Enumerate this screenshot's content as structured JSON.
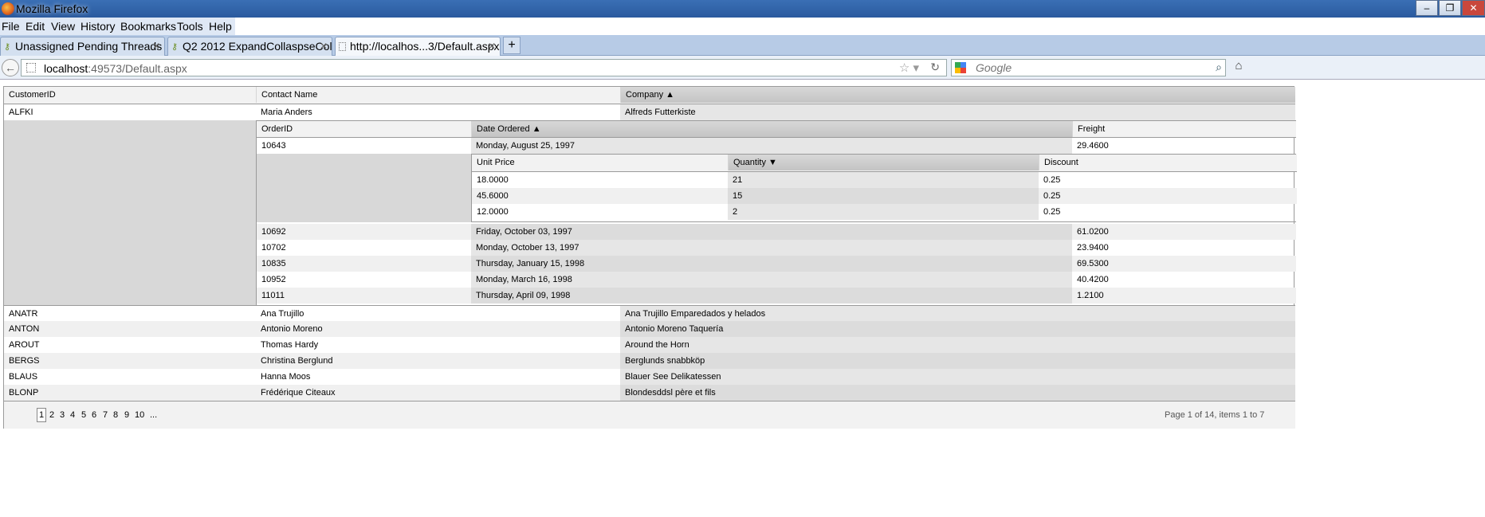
{
  "window": {
    "title": "Mozilla Firefox",
    "controls": [
      "–",
      "❐",
      "✕"
    ]
  },
  "menu": [
    "File",
    "Edit",
    "View",
    "History",
    "Bookmarks",
    "Tools",
    "Help"
  ],
  "tabs": [
    {
      "label": "Unassigned Pending Threads",
      "icon": "key-icon"
    },
    {
      "label": "Q2 2012 ExpandCollaspseCol...",
      "icon": "key-icon"
    },
    {
      "label": "http://localhos...3/Default.aspx",
      "icon": "page-icon"
    }
  ],
  "newtab": "+",
  "nav": {
    "url_host": "localhost",
    "url_rest": ":49573/Default.aspx",
    "search_placeholder": "Google"
  },
  "grid": {
    "headers": {
      "customer_id": "CustomerID",
      "contact": "Contact Name",
      "company": "Company ▲"
    },
    "customers_top": [
      {
        "id": "ALFKI",
        "contact": "Maria Anders",
        "company": "Alfreds Futterkiste"
      }
    ],
    "orders_headers": {
      "order_id": "OrderID",
      "date": "Date Ordered ▲",
      "freight": "Freight"
    },
    "order_first": {
      "id": "10643",
      "date": "Monday, August 25, 1997",
      "freight": "29.4600"
    },
    "details_headers": {
      "price": "Unit Price",
      "qty": "Quantity ▼",
      "discount": "Discount"
    },
    "details": [
      {
        "price": "18.0000",
        "qty": "21",
        "discount": "0.25"
      },
      {
        "price": "45.6000",
        "qty": "15",
        "discount": "0.25"
      },
      {
        "price": "12.0000",
        "qty": "2",
        "discount": "0.25"
      }
    ],
    "orders": [
      {
        "id": "10692",
        "date": "Friday, October 03, 1997",
        "freight": "61.0200"
      },
      {
        "id": "10702",
        "date": "Monday, October 13, 1997",
        "freight": "23.9400"
      },
      {
        "id": "10835",
        "date": "Thursday, January 15, 1998",
        "freight": "69.5300"
      },
      {
        "id": "10952",
        "date": "Monday, March 16, 1998",
        "freight": "40.4200"
      },
      {
        "id": "11011",
        "date": "Thursday, April 09, 1998",
        "freight": "1.2100"
      }
    ],
    "customers": [
      {
        "id": "ANATR",
        "contact": "Ana Trujillo",
        "company": "Ana Trujillo Emparedados y helados"
      },
      {
        "id": "ANTON",
        "contact": "Antonio Moreno",
        "company": "Antonio Moreno Taquería"
      },
      {
        "id": "AROUT",
        "contact": "Thomas Hardy",
        "company": "Around the Horn"
      },
      {
        "id": "BERGS",
        "contact": "Christina Berglund",
        "company": "Berglunds snabbköp"
      },
      {
        "id": "BLAUS",
        "contact": "Hanna Moos",
        "company": "Blauer See Delikatessen"
      },
      {
        "id": "BLONP",
        "contact": "Frédérique Citeaux",
        "company": "Blondesddsl père et fils"
      }
    ],
    "pager": {
      "pages": [
        "1",
        "2",
        "3",
        "4",
        "5",
        "6",
        "7",
        "8",
        "9",
        "10",
        "..."
      ],
      "current": "1",
      "info": "Page 1 of 14, items 1 to 7"
    }
  }
}
